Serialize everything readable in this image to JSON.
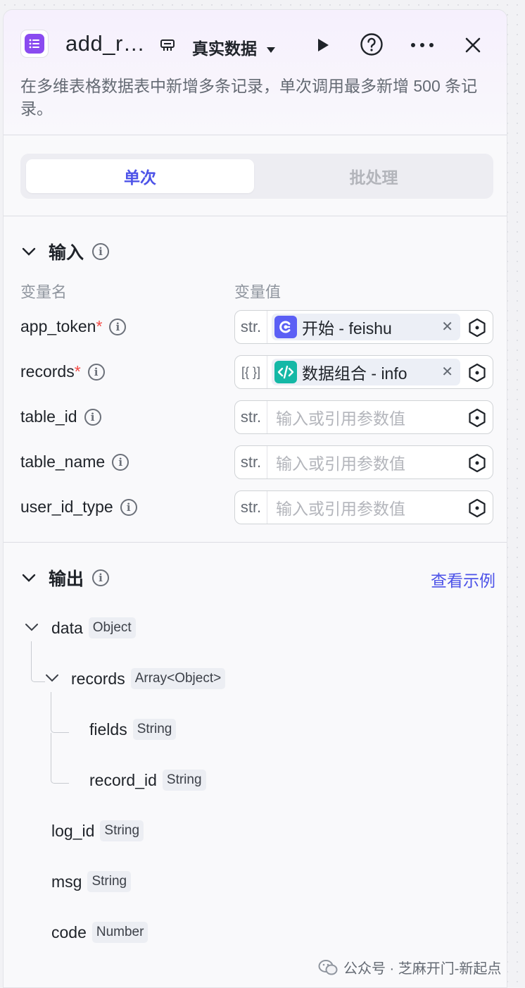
{
  "header": {
    "title": "add_r…",
    "mode_label": "真实数据",
    "description": "在多维表格数据表中新增多条记录，单次调用最多新增 500 条记录。"
  },
  "tabs": {
    "single": "单次",
    "batch": "批处理"
  },
  "input": {
    "title": "输入",
    "col_name": "变量名",
    "col_value": "变量值",
    "params": [
      {
        "name": "app_token",
        "required": "*",
        "type": "str.",
        "ref_label": "开始 - feishu",
        "placeholder": ""
      },
      {
        "name": "records",
        "required": "*",
        "type": "[{ }]",
        "ref_label": "数据组合 - info",
        "placeholder": ""
      },
      {
        "name": "table_id",
        "required": "",
        "type": "str.",
        "ref_label": "",
        "placeholder": "输入或引用参数值"
      },
      {
        "name": "table_name",
        "required": "",
        "type": "str.",
        "ref_label": "",
        "placeholder": "输入或引用参数值"
      },
      {
        "name": "user_id_type",
        "required": "",
        "type": "str.",
        "ref_label": "",
        "placeholder": "输入或引用参数值"
      }
    ]
  },
  "output": {
    "title": "输出",
    "example_link": "查看示例",
    "tree": [
      {
        "name": "data",
        "type": "Object"
      },
      {
        "name": "records",
        "type": "Array<Object>"
      },
      {
        "name": "fields",
        "type": "String"
      },
      {
        "name": "record_id",
        "type": "String"
      },
      {
        "name": "log_id",
        "type": "String"
      },
      {
        "name": "msg",
        "type": "String"
      },
      {
        "name": "code",
        "type": "Number"
      }
    ]
  },
  "watermark": "公众号 · 芝麻开门-新起点",
  "colors": {
    "accent": "#4d53e8",
    "node_icon": "#8a4bf0",
    "start_chip": "#5b5ff5",
    "data_chip": "#14b8a6",
    "required": "#f54a45"
  }
}
